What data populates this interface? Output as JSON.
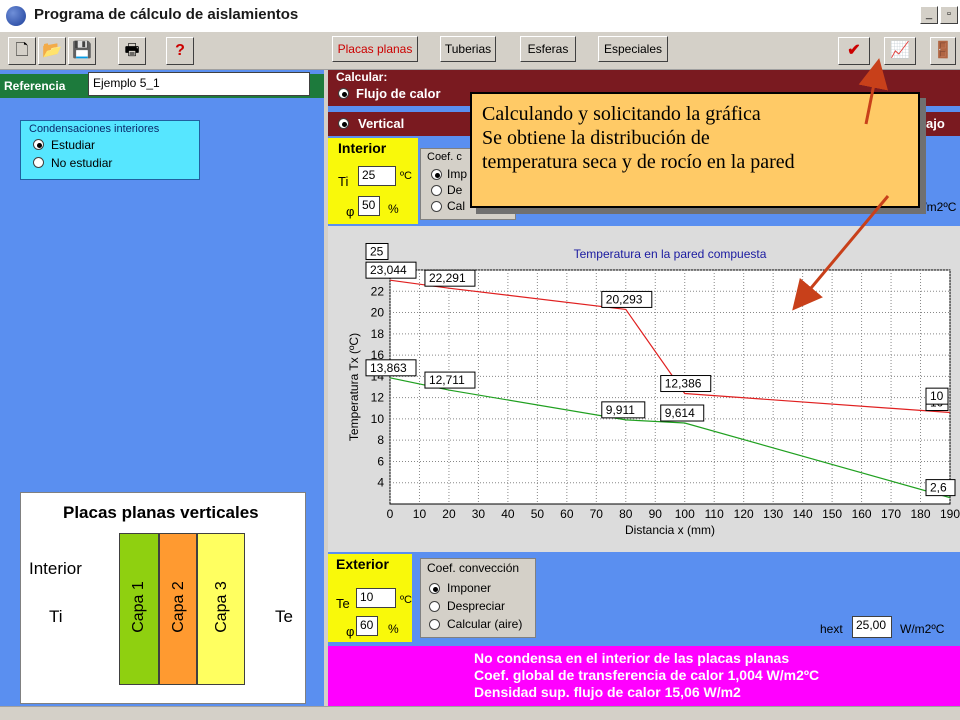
{
  "window": {
    "title": "Programa de cálculo de aislamientos"
  },
  "toolbar": {
    "tabs": [
      "Placas planas",
      "Tuberias",
      "Esferas",
      "Especiales"
    ]
  },
  "reference": {
    "label": "Referencia",
    "value": "Ejemplo 5_1"
  },
  "condensation": {
    "legend": "Condensaciones interiores",
    "options": [
      "Estudiar",
      "No estudiar"
    ]
  },
  "calc": {
    "label": "Calcular:",
    "option": "Flujo de calor",
    "orientation": "Vertical",
    "right_text": "ajo"
  },
  "interior": {
    "title": "Interior",
    "ti_label": "Ti",
    "ti_value": "25",
    "ti_unit": "ºC",
    "phi_label": "φ",
    "phi_value": "50",
    "phi_unit": "%",
    "coef_legend": "Coef. c",
    "coef_options": [
      "Imp",
      "De",
      "Cal"
    ],
    "unit_right": "W/m2ºC"
  },
  "callout": {
    "lines": [
      "Calculando y solicitando la gráfica",
      "Se obtiene la distribución de",
      "temperatura seca y de rocío en la pared"
    ]
  },
  "chart_data": {
    "type": "line",
    "title": "Temperatura en la pared compuesta",
    "xlabel": "Distancia x (mm)",
    "ylabel": "Temperatura Tx (ºC)",
    "xlim": [
      0,
      190
    ],
    "ylim": [
      2,
      24
    ],
    "xticks": [
      0,
      10,
      20,
      30,
      40,
      50,
      60,
      70,
      80,
      90,
      100,
      110,
      120,
      130,
      140,
      150,
      160,
      170,
      180,
      190
    ],
    "yticks": [
      4,
      6,
      8,
      10,
      12,
      14,
      16,
      18,
      20,
      22,
      24
    ],
    "grid": true,
    "series": [
      {
        "color": "#e02020",
        "x": [
          0,
          20,
          80,
          100,
          190
        ],
        "y": [
          23.044,
          22.291,
          20.293,
          12.386,
          10.6
        ]
      },
      {
        "color": "#20a020",
        "x": [
          0,
          20,
          80,
          100,
          190
        ],
        "y": [
          13.863,
          12.711,
          9.911,
          9.614,
          2.6
        ]
      }
    ],
    "labels": [
      {
        "text": "25",
        "x": 0,
        "y": 24.8
      },
      {
        "text": "23,044",
        "x": 0,
        "y": 23.044
      },
      {
        "text": "22,291",
        "x": 20,
        "y": 22.291
      },
      {
        "text": "20,293",
        "x": 80,
        "y": 20.293
      },
      {
        "text": "13,863",
        "x": 0,
        "y": 13.863
      },
      {
        "text": "12,711",
        "x": 20,
        "y": 12.711
      },
      {
        "text": "12,386",
        "x": 100,
        "y": 12.386
      },
      {
        "text": "9,911",
        "x": 80,
        "y": 9.911
      },
      {
        "text": "9,614",
        "x": 100,
        "y": 9.614
      },
      {
        "text": "10",
        "x": 190,
        "y": 10.6
      },
      {
        "text": "10",
        "x": 190,
        "y": 11.2
      },
      {
        "text": "2,6",
        "x": 190,
        "y": 2.6
      }
    ]
  },
  "exterior": {
    "title": "Exterior",
    "te_label": "Te",
    "te_value": "10",
    "te_unit": "ºC",
    "phi_label": "φ",
    "phi_value": "60",
    "phi_unit": "%",
    "coef_legend": "Coef. convección",
    "coef_options": [
      "Imponer",
      "Despreciar",
      "Calcular (aire)"
    ],
    "hext_label": "hext",
    "hext_value": "25,00",
    "hext_unit": "W/m2ºC"
  },
  "results": [
    "No condensa en el interior de las placas planas",
    "Coef. global de transferencia de calor 1,004 W/m2ºC",
    "Densidad sup. flujo de calor 15,06 W/m2"
  ],
  "schematic": {
    "title": "Placas planas verticales",
    "interior": "Interior",
    "ti": "Ti",
    "te": "Te",
    "layers": [
      "Capa 1",
      "Capa 2",
      "Capa 3"
    ],
    "layer_colors": [
      "#8fd010",
      "#ff9a30",
      "#ffff60"
    ]
  }
}
